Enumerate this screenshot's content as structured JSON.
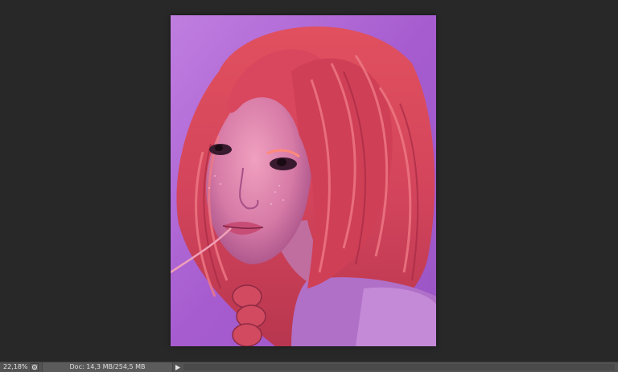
{
  "statusbar": {
    "zoom": "22,18%",
    "doc_info": "Doc: 14,3 MB/254,5 MB",
    "info_icon": "info-icon",
    "arrow_icon": "play-right-icon"
  },
  "colors": {
    "workspace": "#282828",
    "statusbar": "#535353",
    "canvas_bg": "#b06ad0",
    "hair": "#d2445a",
    "skin": "#d97fa6"
  }
}
